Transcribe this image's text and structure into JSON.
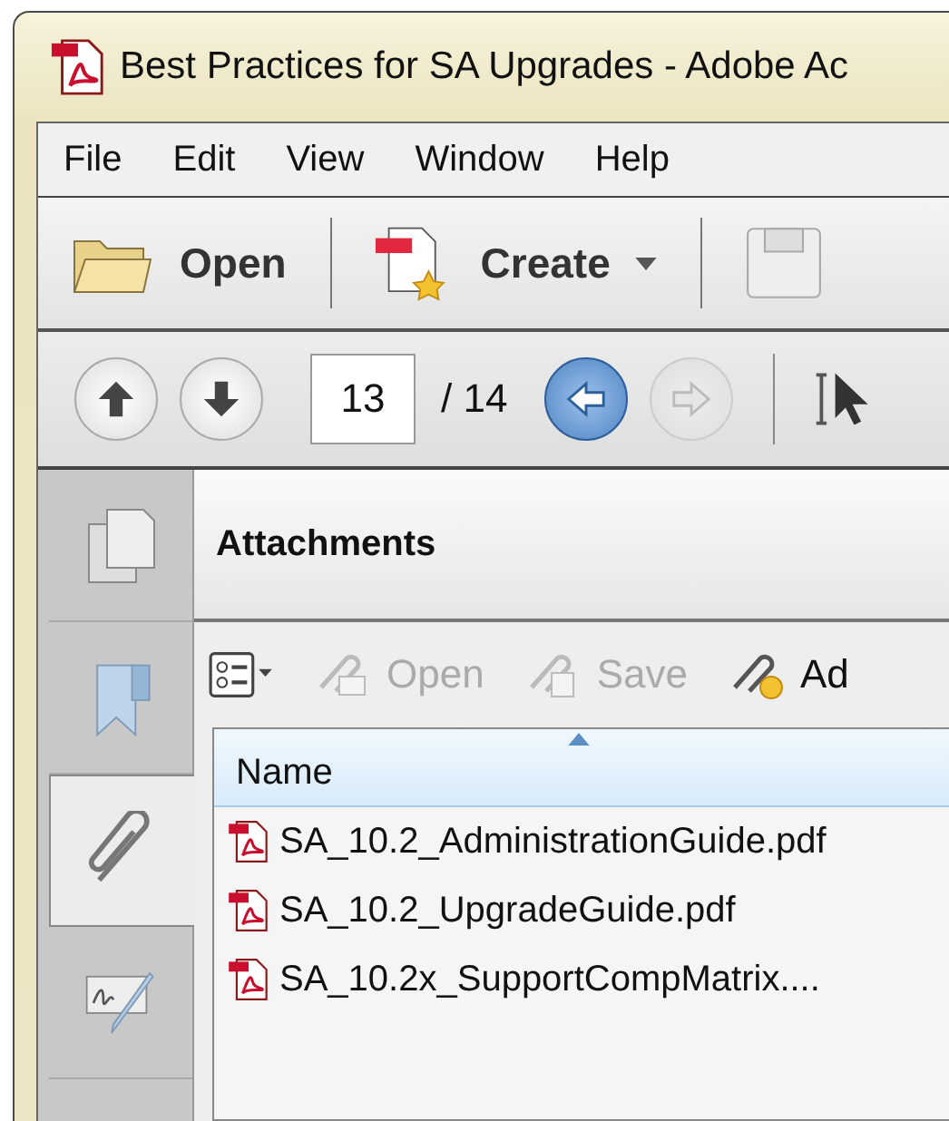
{
  "window": {
    "title": "Best Practices for SA Upgrades - Adobe Ac"
  },
  "menu": [
    "File",
    "Edit",
    "View",
    "Window",
    "Help"
  ],
  "toolbar": [
    {
      "kind": "open",
      "label": "Open"
    },
    {
      "kind": "create",
      "label": "Create"
    },
    {
      "kind": "save"
    }
  ],
  "navigation": {
    "buttons": [
      {
        "kind": "up",
        "disabled": false
      },
      {
        "kind": "down",
        "disabled": false
      }
    ],
    "page": "13",
    "total": "/ 14",
    "history": [
      {
        "kind": "back",
        "disabled": false
      },
      {
        "kind": "forward",
        "disabled": true
      }
    ]
  },
  "side_tabs": [
    {
      "kind": "pages",
      "selected": false
    },
    {
      "kind": "bookmarks",
      "selected": false
    },
    {
      "kind": "attachments",
      "selected": true
    },
    {
      "kind": "signatures",
      "selected": false
    }
  ],
  "panel": {
    "title": "Attachments",
    "tools": [
      {
        "kind": "options"
      },
      {
        "kind": "open",
        "label": "Open",
        "disabled": true
      },
      {
        "kind": "save",
        "label": "Save",
        "disabled": true
      },
      {
        "kind": "add",
        "label": "Ad",
        "disabled": false
      }
    ],
    "columns": [
      "Name"
    ],
    "files": [
      "SA_10.2_AdministrationGuide.pdf",
      "SA_10.2_UpgradeGuide.pdf",
      "SA_10.2x_SupportCompMatrix...."
    ]
  }
}
